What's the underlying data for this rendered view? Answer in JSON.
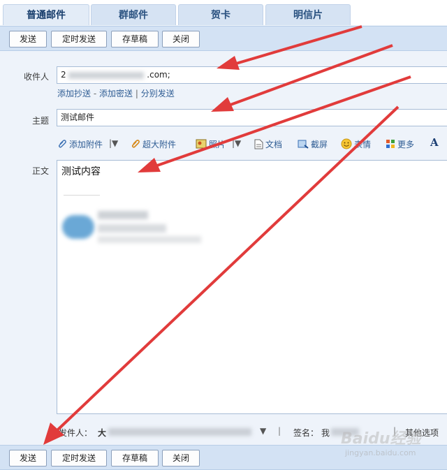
{
  "tabs": [
    {
      "label": "普通邮件"
    },
    {
      "label": "群邮件"
    },
    {
      "label": "贺卡"
    },
    {
      "label": "明信片"
    }
  ],
  "toolbar": {
    "send": "发送",
    "scheduled_send": "定时发送",
    "save_draft": "存草稿",
    "close": "关闭"
  },
  "form": {
    "recipient_label": "收件人",
    "recipient_prefix": "2",
    "recipient_suffix": ".com;",
    "add_cc": "添加抄送",
    "dash": "-",
    "add_bcc": "添加密送",
    "pipe": "|",
    "separate_send": "分别发送",
    "subject_label": "主题",
    "subject_value": "测试邮件",
    "body_label": "正文",
    "body_text": "测试内容"
  },
  "attach_bar": {
    "add_attachment": "添加附件",
    "large_attachment": "超大附件",
    "photo": "照片",
    "document": "文档",
    "screenshot": "截屏",
    "emoji": "表情",
    "more": "更多",
    "font_icon_label": "A"
  },
  "footer": {
    "sender_label": "发件人：",
    "sender_value": "大",
    "signature_label": "签名：",
    "signature_value": "我",
    "other_options": "其他选项",
    "sep": "|"
  },
  "watermark": {
    "brand": "Baidu经验",
    "url": "jingyan.baidu.com"
  },
  "colors": {
    "arrow": "#e13b3b",
    "tab_bg": "#d6e3f3",
    "toolbar_bg": "#d3e2f4",
    "link": "#2f5d94"
  }
}
